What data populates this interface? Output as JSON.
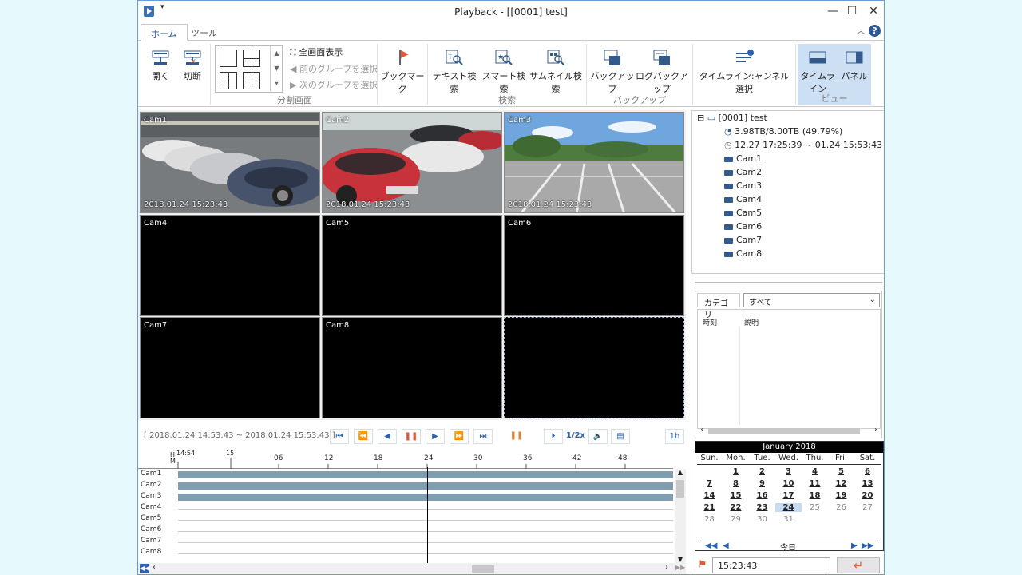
{
  "window": {
    "title": "Playback - [[0001] test]"
  },
  "tabs": [
    "ホーム",
    "ツール"
  ],
  "ribbon": {
    "open": "開く",
    "disconnect": "切断",
    "fullscreen": "全画面表示",
    "prev_group": "前のグループを選択",
    "next_group": "次のグループを選択",
    "split_group": "分割画面",
    "bookmark": "ブックマーク",
    "text_search": "テキスト検索",
    "smart_search": "スマート検索",
    "thumb_search": "サムネイル検索",
    "search_group": "検索",
    "backup": "バックアップ",
    "log_backup": "ログバックアップ",
    "backup_group": "バックアップ",
    "timeline_channel": "タイムライン:ャンネル選択",
    "timeline": "タイムライン",
    "panel": "パネル",
    "view_group": "ビュー"
  },
  "videos": [
    {
      "label": "Cam1",
      "ts": "2018.01.24 15:23:43"
    },
    {
      "label": "Cam2",
      "ts": "2018.01.24 15:23:43"
    },
    {
      "label": "Cam3",
      "ts": "2018.01.24 15:23:43"
    },
    {
      "label": "Cam4"
    },
    {
      "label": "Cam5"
    },
    {
      "label": "Cam6"
    },
    {
      "label": "Cam7"
    },
    {
      "label": "Cam8"
    }
  ],
  "playback": {
    "range": "[ 2018.01.24 14:53:43 ~ 2018.01.24 15:53:43 ]",
    "speed": "1/2x",
    "span": "1h"
  },
  "timeline": {
    "hour_label": "H",
    "min_label": "M",
    "start_hour": "14:54",
    "hour_mark": "15",
    "ticks": [
      "06",
      "12",
      "18",
      "24",
      "30",
      "36",
      "42",
      "48"
    ],
    "cams": [
      "Cam1",
      "Cam2",
      "Cam3",
      "Cam4",
      "Cam5",
      "Cam6",
      "Cam7",
      "Cam8"
    ]
  },
  "tree": {
    "root": "[0001] test",
    "storage": "3.98TB/8.00TB (49.79%)",
    "range": "12.27 17:25:39 ~ 01.24 15:53:43",
    "cams": [
      "Cam1",
      "Cam2",
      "Cam3",
      "Cam4",
      "Cam5",
      "Cam6",
      "Cam7",
      "Cam8"
    ]
  },
  "events": {
    "category_label": "カテゴリ",
    "category_value": "すべて",
    "col_time": "時刻",
    "col_desc": "説明"
  },
  "calendar": {
    "month": "January 2018",
    "dows": [
      "Sun.",
      "Mon.",
      "Tue.",
      "Wed.",
      "Thu.",
      "Fri.",
      "Sat."
    ],
    "today_label": "今日"
  },
  "time_value": "15:23:43"
}
